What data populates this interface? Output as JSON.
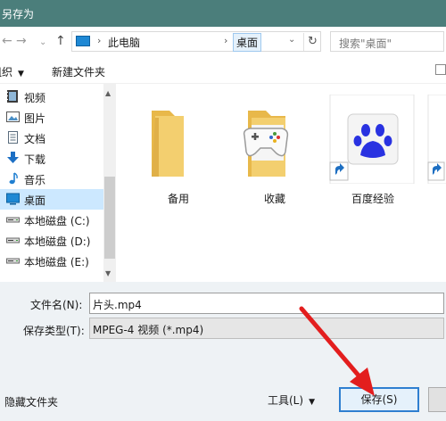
{
  "window": {
    "title": "另存为"
  },
  "nav": {
    "back": "←",
    "forward": "→",
    "recent": "⌄",
    "up": "↑"
  },
  "address": {
    "separator": "›",
    "crumbs": [
      "此电脑",
      "桌面"
    ],
    "dropdown": "⌄",
    "refresh": "↻"
  },
  "search": {
    "placeholder": "搜索\"桌面\""
  },
  "toolbar": {
    "organize": "组织",
    "organize_caret": "▼",
    "new_folder": "新建文件夹"
  },
  "sidebar": {
    "scroll_up": "▲",
    "scroll_down": "▼",
    "items": [
      {
        "label": "视频",
        "icon": "video-icon"
      },
      {
        "label": "图片",
        "icon": "pictures-icon"
      },
      {
        "label": "文档",
        "icon": "documents-icon"
      },
      {
        "label": "下载",
        "icon": "download-icon"
      },
      {
        "label": "音乐",
        "icon": "music-icon"
      },
      {
        "label": "桌面",
        "icon": "desktop-icon",
        "active": true
      },
      {
        "label": "本地磁盘 (C:)",
        "icon": "drive-icon"
      },
      {
        "label": "本地磁盘 (D:)",
        "icon": "drive-icon"
      },
      {
        "label": "本地磁盘 (E:)",
        "icon": "drive-icon"
      }
    ]
  },
  "files": [
    {
      "name": "备用",
      "icon": "folder-icon"
    },
    {
      "name": "收藏",
      "icon": "game-folder-icon"
    },
    {
      "name": "百度经验",
      "icon": "baidu-paw-shortcut-icon"
    }
  ],
  "form": {
    "filename_label": "文件名(N):",
    "filename_value": "片头.mp4",
    "filetype_label": "保存类型(T):",
    "filetype_value": "MPEG-4 视频 (*.mp4)"
  },
  "footer": {
    "hide_folders": "隐藏文件夹",
    "tools": "工具(L)",
    "tools_caret": "▼",
    "save": "保存(S)"
  },
  "colors": {
    "titlebar": "#4b7e7b",
    "selection": "#cce8ff",
    "accent": "#2f7fd0",
    "folder": "#f3cf6f",
    "baidu": "#2932e1",
    "arrow": "#e31e1e"
  }
}
